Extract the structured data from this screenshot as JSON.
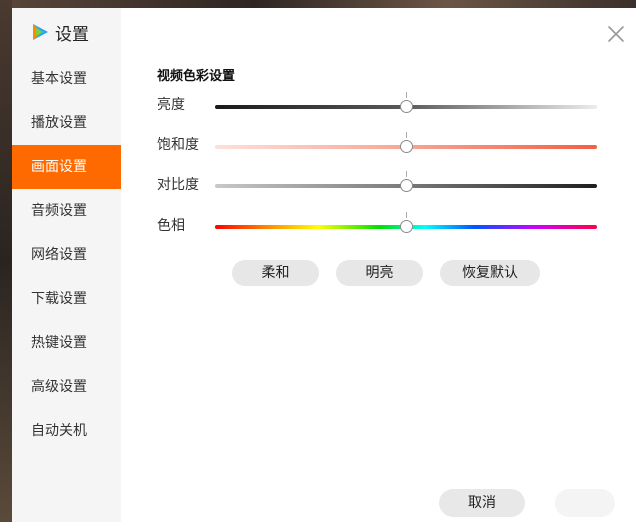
{
  "app": {
    "title": "设置"
  },
  "sidebar": {
    "items": [
      {
        "label": "基本设置"
      },
      {
        "label": "播放设置"
      },
      {
        "label": "画面设置",
        "active": true
      },
      {
        "label": "音频设置"
      },
      {
        "label": "网络设置"
      },
      {
        "label": "下载设置"
      },
      {
        "label": "热键设置"
      },
      {
        "label": "高级设置"
      },
      {
        "label": "自动关机"
      }
    ]
  },
  "content": {
    "section_title": "视频色彩设置",
    "sliders": [
      {
        "label": "亮度",
        "value_fraction": 0.5
      },
      {
        "label": "饱和度",
        "value_fraction": 0.5
      },
      {
        "label": "对比度",
        "value_fraction": 0.5
      },
      {
        "label": "色相",
        "value_fraction": 0.5
      }
    ],
    "presets": {
      "soft": "柔和",
      "bright": "明亮",
      "reset": "恢复默认"
    }
  },
  "footer": {
    "cancel": "取消"
  },
  "colors": {
    "accent": "#ff6a00"
  },
  "icons": {
    "logo": "tencent-video-logo-icon",
    "close": "close-icon"
  }
}
